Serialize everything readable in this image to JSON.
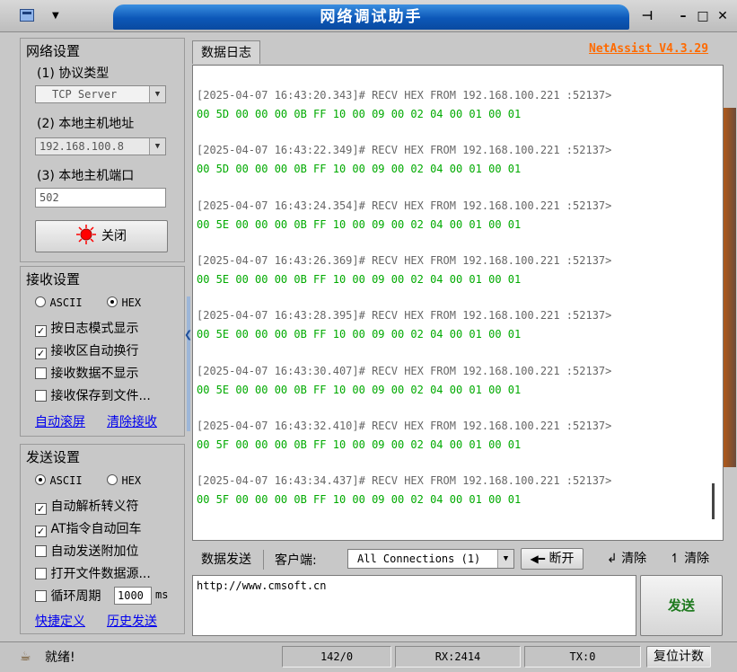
{
  "window": {
    "title": "网络调试助手",
    "pin_glyph": "⊣",
    "minimize_glyph": "–",
    "maximize_glyph": "□",
    "close_glyph": "✕",
    "menu_arrow": "▼"
  },
  "network_settings": {
    "group_title": "网络设置",
    "protocol_label": "(1) 协议类型",
    "protocol_value": "TCP Server",
    "host_label": "(2) 本地主机地址",
    "host_value": "192.168.100.8",
    "port_label": "(3) 本地主机端口",
    "port_value": "502",
    "close_button": "关闭"
  },
  "receive_settings": {
    "group_title": "接收设置",
    "ascii_label": "ASCII",
    "hex_label": "HEX",
    "options": [
      {
        "label": "按日志模式显示",
        "checked": true
      },
      {
        "label": "接收区自动换行",
        "checked": true
      },
      {
        "label": "接收数据不显示",
        "checked": false
      },
      {
        "label": "接收保存到文件...",
        "checked": false
      }
    ],
    "auto_scroll_link": "自动滚屏",
    "clear_link": "清除接收"
  },
  "send_settings": {
    "group_title": "发送设置",
    "ascii_label": "ASCII",
    "hex_label": "HEX",
    "options": [
      {
        "label": "自动解析转义符",
        "checked": true
      },
      {
        "label": "AT指令自动回车",
        "checked": true
      },
      {
        "label": "自动发送附加位",
        "checked": false
      },
      {
        "label": "打开文件数据源...",
        "checked": false
      }
    ],
    "cycle_label": "循环周期",
    "cycle_value": "1000",
    "cycle_unit": "ms",
    "shortcut_link": "快捷定义",
    "history_link": "历史发送"
  },
  "log": {
    "tab_label": "数据日志",
    "version": "NetAssist V4.3.29",
    "entries": [
      {
        "head": "[2025-04-07 16:43:20.343]# RECV HEX FROM 192.168.100.221 :52137>",
        "data": "00 5D 00 00 00 0B FF 10 00 09 00 02 04 00 01 00 01"
      },
      {
        "head": "[2025-04-07 16:43:22.349]# RECV HEX FROM 192.168.100.221 :52137>",
        "data": "00 5D 00 00 00 0B FF 10 00 09 00 02 04 00 01 00 01"
      },
      {
        "head": "[2025-04-07 16:43:24.354]# RECV HEX FROM 192.168.100.221 :52137>",
        "data": "00 5E 00 00 00 0B FF 10 00 09 00 02 04 00 01 00 01"
      },
      {
        "head": "[2025-04-07 16:43:26.369]# RECV HEX FROM 192.168.100.221 :52137>",
        "data": "00 5E 00 00 00 0B FF 10 00 09 00 02 04 00 01 00 01"
      },
      {
        "head": "[2025-04-07 16:43:28.395]# RECV HEX FROM 192.168.100.221 :52137>",
        "data": "00 5E 00 00 00 0B FF 10 00 09 00 02 04 00 01 00 01"
      },
      {
        "head": "[2025-04-07 16:43:30.407]# RECV HEX FROM 192.168.100.221 :52137>",
        "data": "00 5E 00 00 00 0B FF 10 00 09 00 02 04 00 01 00 01"
      },
      {
        "head": "[2025-04-07 16:43:32.410]# RECV HEX FROM 192.168.100.221 :52137>",
        "data": "00 5F 00 00 00 0B FF 10 00 09 00 02 04 00 01 00 01"
      },
      {
        "head": "[2025-04-07 16:43:34.437]# RECV HEX FROM 192.168.100.221 :52137>",
        "data": "00 5F 00 00 00 0B FF 10 00 09 00 02 04 00 01 00 01"
      }
    ]
  },
  "send": {
    "tab_label": "数据发送",
    "client_label": "客户端:",
    "connections_value": "All Connections (1)",
    "disconnect_button": "断开",
    "clear_button_1": "清除",
    "clear_button_2": "清除",
    "input_value": "http://www.cmsoft.cn",
    "send_button": "发送"
  },
  "status": {
    "ready_text": "就绪!",
    "counter": "142/0",
    "rx": "RX:2414",
    "tx": "TX:0",
    "reset_button": "复位计数"
  },
  "colors": {
    "title_blue": "#0c57b8",
    "version_orange": "#ff6a00",
    "log_data_green": "#00aa00",
    "status_led_red": "#ff0000"
  }
}
